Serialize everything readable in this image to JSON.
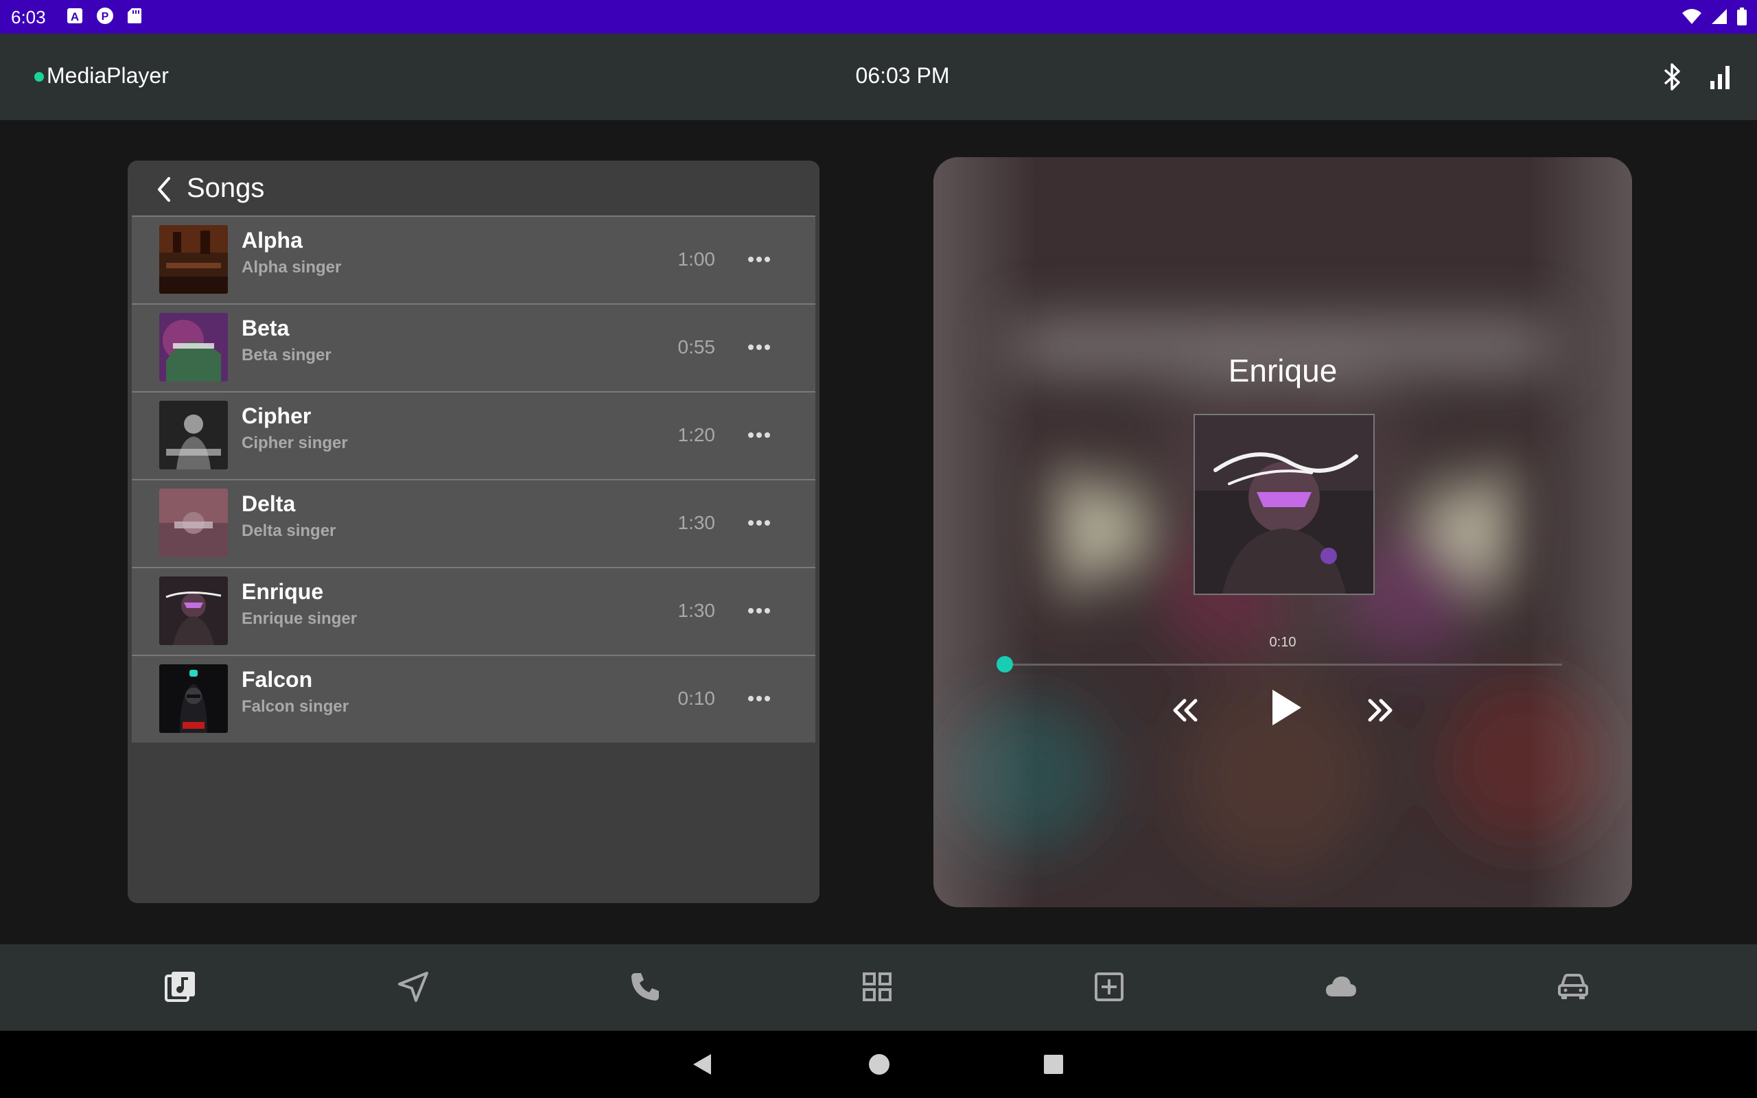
{
  "status_bar": {
    "time": "6:03"
  },
  "top_bar": {
    "app_title": "MediaPlayer",
    "clock": "06:03 PM",
    "status_color": "#19d39a"
  },
  "songs_panel": {
    "title": "Songs",
    "songs": [
      {
        "name": "Alpha",
        "artist": "Alpha singer",
        "duration": "1:00"
      },
      {
        "name": "Beta",
        "artist": "Beta singer",
        "duration": "0:55"
      },
      {
        "name": "Cipher",
        "artist": "Cipher singer",
        "duration": "1:20"
      },
      {
        "name": "Delta",
        "artist": "Delta singer",
        "duration": "1:30"
      },
      {
        "name": "Enrique",
        "artist": "Enrique singer",
        "duration": "1:30"
      },
      {
        "name": "Falcon",
        "artist": "Falcon singer",
        "duration": "0:10"
      }
    ]
  },
  "player": {
    "title": "Enrique",
    "elapsed": "0:10",
    "progress": 0.0,
    "accent": "#19cdb4"
  },
  "bottom_nav": {
    "items": [
      "music-library-icon",
      "navigation-icon",
      "phone-icon",
      "apps-grid-icon",
      "add-box-icon",
      "cloud-icon",
      "car-icon"
    ]
  }
}
